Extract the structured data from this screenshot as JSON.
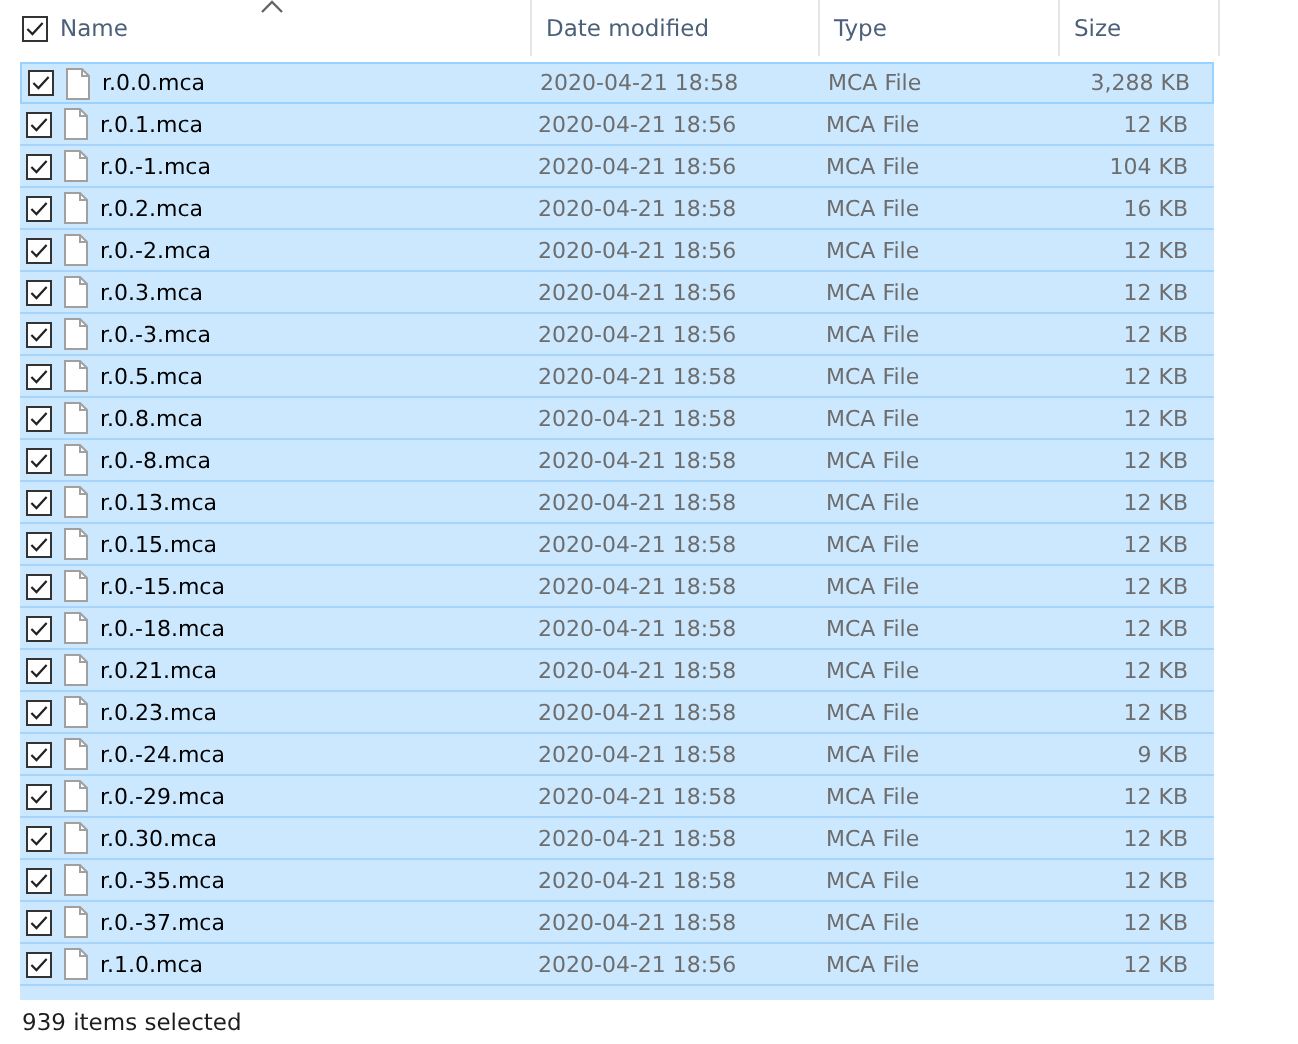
{
  "header": {
    "select_all_checked": true,
    "columns": [
      {
        "label": "Name",
        "sorted": true
      },
      {
        "label": "Date modified",
        "sorted": false
      },
      {
        "label": "Type",
        "sorted": false
      },
      {
        "label": "Size",
        "sorted": false
      }
    ]
  },
  "rows": [
    {
      "name": "r.0.0.mca",
      "date": "2020-04-21 18:58",
      "type": "MCA File",
      "size": "3,288 KB",
      "selected": true,
      "focused": true
    },
    {
      "name": "r.0.1.mca",
      "date": "2020-04-21 18:56",
      "type": "MCA File",
      "size": "12 KB",
      "selected": true,
      "focused": false
    },
    {
      "name": "r.0.-1.mca",
      "date": "2020-04-21 18:56",
      "type": "MCA File",
      "size": "104 KB",
      "selected": true,
      "focused": false
    },
    {
      "name": "r.0.2.mca",
      "date": "2020-04-21 18:58",
      "type": "MCA File",
      "size": "16 KB",
      "selected": true,
      "focused": false
    },
    {
      "name": "r.0.-2.mca",
      "date": "2020-04-21 18:56",
      "type": "MCA File",
      "size": "12 KB",
      "selected": true,
      "focused": false
    },
    {
      "name": "r.0.3.mca",
      "date": "2020-04-21 18:56",
      "type": "MCA File",
      "size": "12 KB",
      "selected": true,
      "focused": false
    },
    {
      "name": "r.0.-3.mca",
      "date": "2020-04-21 18:56",
      "type": "MCA File",
      "size": "12 KB",
      "selected": true,
      "focused": false
    },
    {
      "name": "r.0.5.mca",
      "date": "2020-04-21 18:58",
      "type": "MCA File",
      "size": "12 KB",
      "selected": true,
      "focused": false
    },
    {
      "name": "r.0.8.mca",
      "date": "2020-04-21 18:58",
      "type": "MCA File",
      "size": "12 KB",
      "selected": true,
      "focused": false
    },
    {
      "name": "r.0.-8.mca",
      "date": "2020-04-21 18:58",
      "type": "MCA File",
      "size": "12 KB",
      "selected": true,
      "focused": false
    },
    {
      "name": "r.0.13.mca",
      "date": "2020-04-21 18:58",
      "type": "MCA File",
      "size": "12 KB",
      "selected": true,
      "focused": false
    },
    {
      "name": "r.0.15.mca",
      "date": "2020-04-21 18:58",
      "type": "MCA File",
      "size": "12 KB",
      "selected": true,
      "focused": false
    },
    {
      "name": "r.0.-15.mca",
      "date": "2020-04-21 18:58",
      "type": "MCA File",
      "size": "12 KB",
      "selected": true,
      "focused": false
    },
    {
      "name": "r.0.-18.mca",
      "date": "2020-04-21 18:58",
      "type": "MCA File",
      "size": "12 KB",
      "selected": true,
      "focused": false
    },
    {
      "name": "r.0.21.mca",
      "date": "2020-04-21 18:58",
      "type": "MCA File",
      "size": "12 KB",
      "selected": true,
      "focused": false
    },
    {
      "name": "r.0.23.mca",
      "date": "2020-04-21 18:58",
      "type": "MCA File",
      "size": "12 KB",
      "selected": true,
      "focused": false
    },
    {
      "name": "r.0.-24.mca",
      "date": "2020-04-21 18:58",
      "type": "MCA File",
      "size": "9 KB",
      "selected": true,
      "focused": false
    },
    {
      "name": "r.0.-29.mca",
      "date": "2020-04-21 18:58",
      "type": "MCA File",
      "size": "12 KB",
      "selected": true,
      "focused": false
    },
    {
      "name": "r.0.30.mca",
      "date": "2020-04-21 18:58",
      "type": "MCA File",
      "size": "12 KB",
      "selected": true,
      "focused": false
    },
    {
      "name": "r.0.-35.mca",
      "date": "2020-04-21 18:58",
      "type": "MCA File",
      "size": "12 KB",
      "selected": true,
      "focused": false
    },
    {
      "name": "r.0.-37.mca",
      "date": "2020-04-21 18:58",
      "type": "MCA File",
      "size": "12 KB",
      "selected": true,
      "focused": false
    },
    {
      "name": "r.1.0.mca",
      "date": "2020-04-21 18:56",
      "type": "MCA File",
      "size": "12 KB",
      "selected": true,
      "focused": false
    }
  ],
  "status_bar": "939 items selected"
}
